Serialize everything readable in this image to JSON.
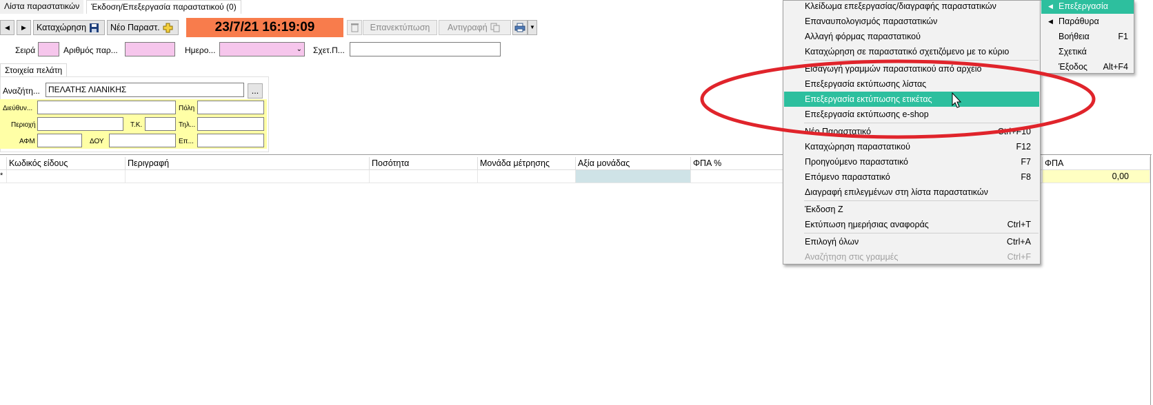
{
  "tabs": {
    "list": "Λίστα παραστατικών",
    "edit": "Έκδοση/Επεξεργασία παραστατικού (0)"
  },
  "toolbar": {
    "prev_icon": "arrow-left-icon",
    "next_icon": "arrow-right-icon",
    "save_label": "Καταχώρηση",
    "new_label": "Νέο Παραστ.",
    "datetime": "23/7/21 16:19:09",
    "reprint_label": "Επανεκτύπωση",
    "copy_label": "Αντιγραφή",
    "print_icon": "printer-icon"
  },
  "header_fields": {
    "series_label": "Σειρά",
    "series_value": "",
    "number_label": "Αριθμός παρ...",
    "number_value": "",
    "date_label": "Ημερο...",
    "date_value": "",
    "related_label": "Σχετ.Π...",
    "related_value": ""
  },
  "customer": {
    "tab_label": "Στοιχεία πελάτη",
    "search_label": "Αναζήτη...",
    "search_value": "ΠΕΛΑΤΗΣ ΛΙΑΝΙΚΗΣ",
    "browse_label": "...",
    "address_label": "Διεύθυν...",
    "city_label": "Πόλη",
    "area_label": "Περιοχή",
    "zip_label": "Τ.Κ.",
    "phone_label": "Τηλ...",
    "afm_label": "ΑΦΜ",
    "doy_label": "ΔΟΥ",
    "occupation_label": "Επ..."
  },
  "grid": {
    "columns": [
      "Κωδικός είδους",
      "Περιγραφή",
      "Ποσότητα",
      "Μονάδα μέτρησης",
      "Αξία μονάδας",
      "ΦΠΑ %",
      "ΦΠΑ"
    ],
    "new_row_marker": "*",
    "total_value": "0,00"
  },
  "context_menu": {
    "items": [
      {
        "label": "Κλείδωμα επεξεργασίας/διαγραφής παραστατικών",
        "shortcut": ""
      },
      {
        "label": "Επαναυπολογισμός παραστατικών",
        "shortcut": ""
      },
      {
        "label": "Αλλαγή φόρμας παραστατικού",
        "shortcut": ""
      },
      {
        "label": "Καταχώρηση σε παραστατικό σχετιζόμενο με το κύριο",
        "shortcut": ""
      },
      {
        "label": "Εισαγωγή γραμμών παραστατικού από αρχείο",
        "shortcut": ""
      },
      {
        "label": "Επεξεργασία εκτύπωσης λίστας",
        "shortcut": ""
      },
      {
        "label": "Επεξεργασία εκτύπωσης ετικέτας",
        "shortcut": ""
      },
      {
        "label": "Επεξεργασία εκτύπωσης e-shop",
        "shortcut": ""
      },
      {
        "label": "Νέο Παραστατικό",
        "shortcut": "Ctrl+F10"
      },
      {
        "label": "Καταχώρηση παραστατικού",
        "shortcut": "F12"
      },
      {
        "label": "Προηγούμενο παραστατικό",
        "shortcut": "F7"
      },
      {
        "label": "Επόμενο παραστατικό",
        "shortcut": "F8"
      },
      {
        "label": "Διαγραφή επιλεγμένων στη λίστα παραστατικών",
        "shortcut": ""
      },
      {
        "label": "Έκδοση Ζ",
        "shortcut": ""
      },
      {
        "label": "Εκτύπωση ημερήσιας αναφοράς",
        "shortcut": "Ctrl+T"
      },
      {
        "label": "Επιλογή όλων",
        "shortcut": "Ctrl+A"
      },
      {
        "label": "Αναζήτηση στις γραμμές",
        "shortcut": "Ctrl+F"
      }
    ]
  },
  "main_menu": {
    "items": [
      {
        "label": "Επεξεργασία",
        "shortcut": ""
      },
      {
        "label": "Παράθυρα",
        "shortcut": ""
      },
      {
        "label": "Βοήθεια",
        "shortcut": "F1"
      },
      {
        "label": "Σχετικά",
        "shortcut": ""
      },
      {
        "label": "Έξοδος",
        "shortcut": "Alt+F4"
      }
    ]
  },
  "colors": {
    "datetime_bg": "#f87c4c",
    "highlight": "#2dbf9e",
    "annotation_ellipse": "#e0242b",
    "pink_field": "#f6c6ec",
    "yellow_panel": "#ffffa6"
  }
}
